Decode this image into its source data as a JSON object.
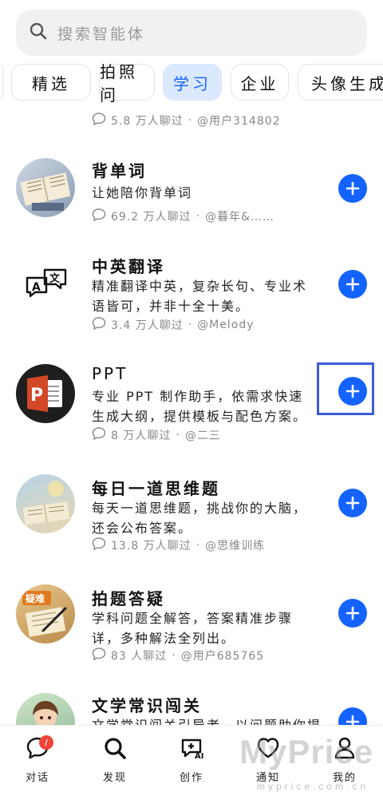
{
  "search": {
    "placeholder": "搜索智能体"
  },
  "tabs": [
    {
      "label": "精选"
    },
    {
      "label": "拍照问"
    },
    {
      "label": "学习",
      "active": true
    },
    {
      "label": "企业"
    },
    {
      "label": "头像生成"
    }
  ],
  "prev_item_meta": {
    "count": "5.8 万人聊过",
    "author": "@用户314802"
  },
  "items": [
    {
      "title": "背单词",
      "desc": "让她陪你背单词",
      "count": "69.2 万人聊过",
      "author": "@暮年&……"
    },
    {
      "title": "中英翻译",
      "desc": "精准翻译中英，复杂长句、专业术语皆可，并非十全十美。",
      "count": "3.4 万人聊过",
      "author": "@Melody"
    },
    {
      "title": "PPT",
      "desc": "专业 PPT 制作助手，依需求快速生成大纲，提供模板与配色方案。",
      "count": "8 万人聊过",
      "author": "@二三"
    },
    {
      "title": "每日一道思维题",
      "desc": "每天一道思维题，挑战你的大脑，还会公布答案。",
      "count": "13.8 万人聊过",
      "author": "@思维训练"
    },
    {
      "title": "拍题答疑",
      "desc": "学科问题全解答，答案精准步骤详，多种解法全列出。",
      "count": "83 人聊过",
      "author": "@用户685765"
    },
    {
      "title": "文学常识闯关",
      "desc": "文学常识闯关引导者，以问题助你提",
      "count": "",
      "author": ""
    }
  ],
  "nav": [
    {
      "label": "对话",
      "badge": "/"
    },
    {
      "label": "发现"
    },
    {
      "label": "创作"
    },
    {
      "label": "通知"
    },
    {
      "label": "我的"
    }
  ],
  "watermark": {
    "brand": "MyPrice",
    "url": "myprice.com.cn"
  },
  "colors": {
    "accent": "#1463ff",
    "tab_active_bg": "#dbe9ff",
    "badge": "#f04438",
    "highlight": "#3b5bdb"
  }
}
